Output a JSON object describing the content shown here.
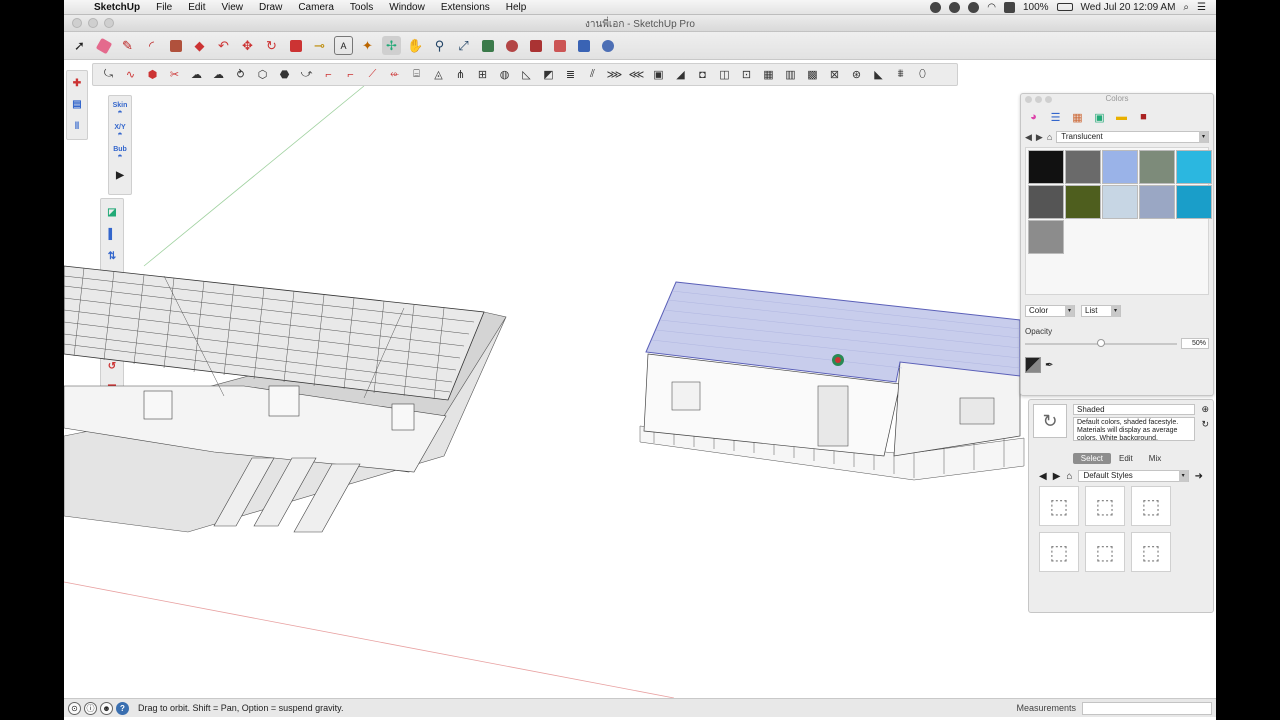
{
  "menubar": {
    "apple": "",
    "app": "SketchUp",
    "items": [
      "File",
      "Edit",
      "View",
      "Draw",
      "Camera",
      "Tools",
      "Window",
      "Extensions",
      "Help"
    ],
    "battery": "100%",
    "clock": "Wed Jul 20  12:09 AM"
  },
  "window": {
    "title": "งานพี่เอก - SketchUp Pro"
  },
  "large_tool_set": {
    "labels": [
      "Skin",
      "X/Y",
      "Bub"
    ]
  },
  "colors_panel": {
    "title": "Colors",
    "library": "Translucent",
    "mode_dropdown": "Color",
    "view_dropdown": "List",
    "opacity_label": "Opacity",
    "opacity_value": "50%",
    "opacity_fraction": 0.5,
    "swatch_colors": [
      "#111111",
      "#6a6a6a",
      "#9ab3e8",
      "#7d8b7a",
      "#2bb7e0",
      "#555555",
      "#4e5e1e",
      "#c7d6e4",
      "#9aa7c4",
      "#1a9ec9",
      "#8c8c8c"
    ]
  },
  "styles_panel": {
    "style_name": "Shaded",
    "style_desc": "Default colors, shaded facestyle. Materials will display as average colors. White background.",
    "tabs": [
      "Select",
      "Edit",
      "Mix"
    ],
    "active_tab": "Select",
    "collection": "Default Styles"
  },
  "statusbar": {
    "hint": "Drag to orbit. Shift = Pan, Option = suspend gravity.",
    "measurements_label": "Measurements"
  }
}
